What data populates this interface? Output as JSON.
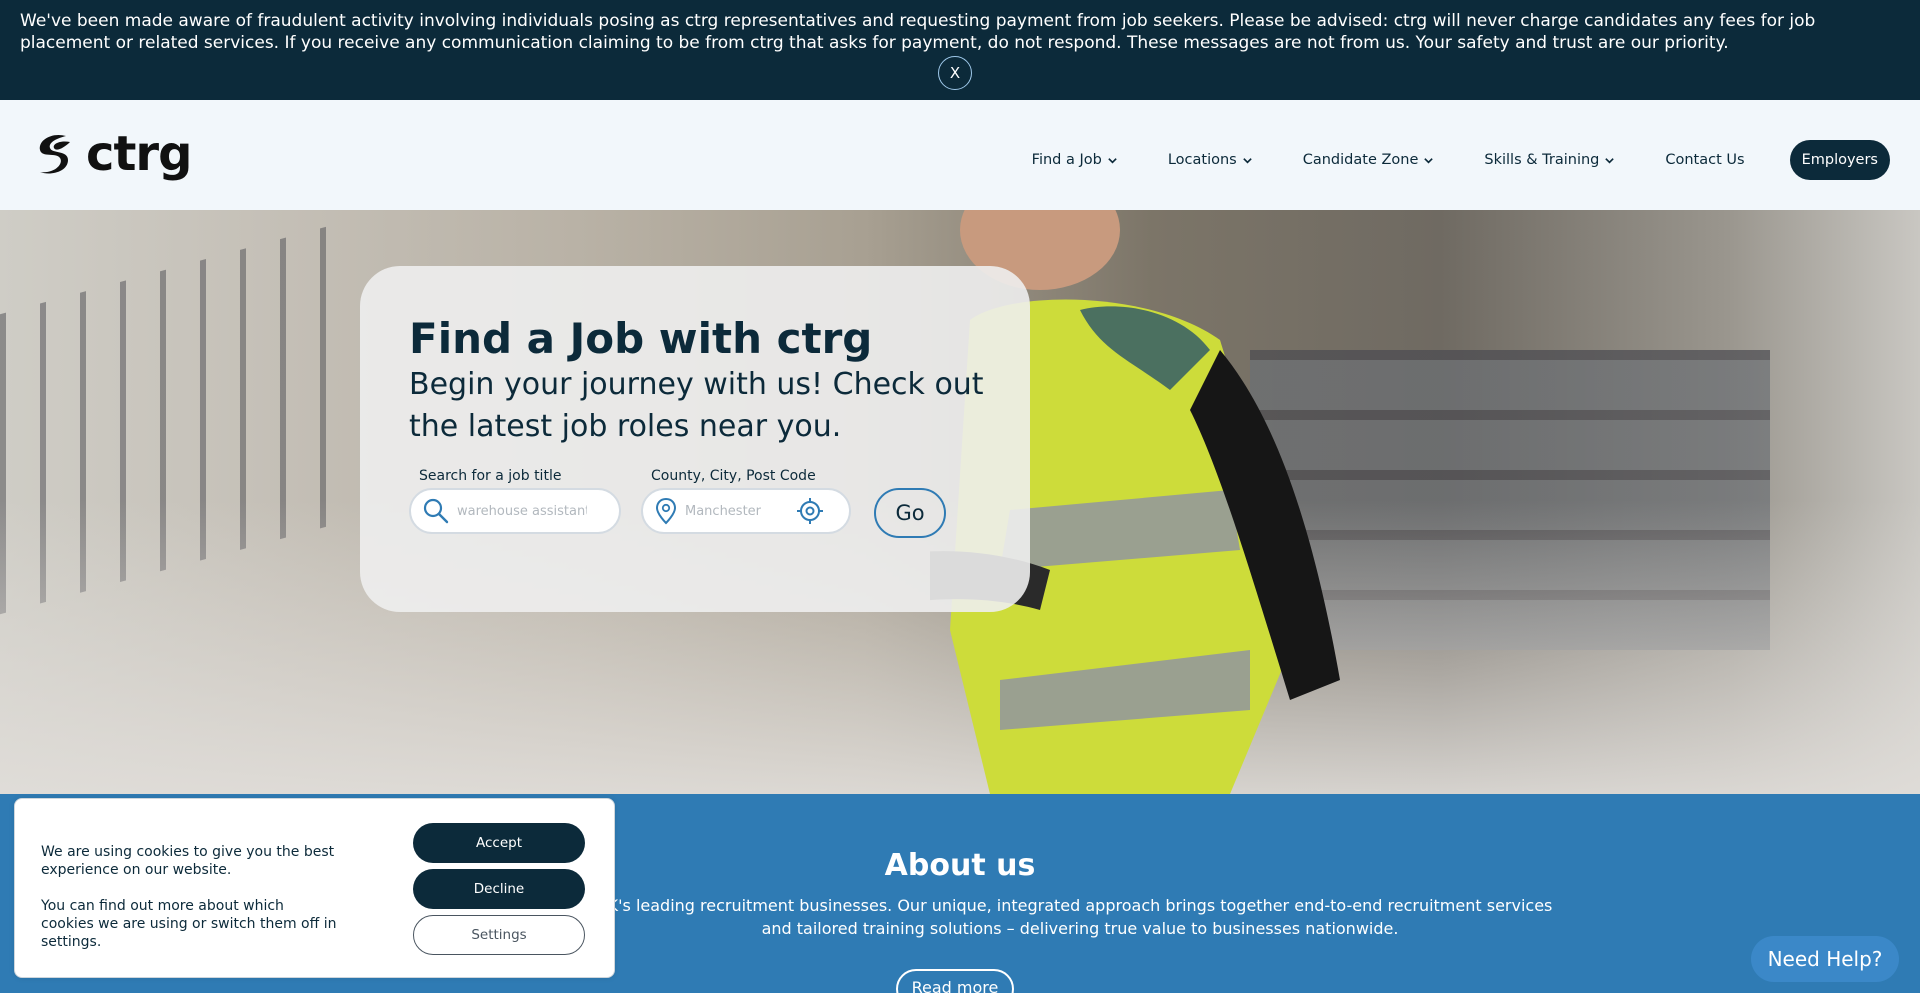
{
  "alert": {
    "message": "We've been made aware of fraudulent activity involving individuals posing as ctrg representatives and requesting payment from job seekers. Please be advised: ctrg will never charge candidates any fees for job placement or related services. If you receive any communication claiming to be from ctrg that asks for payment, do not respond. These messages are not from us. Your safety and trust are our priority.",
    "close_label": "X"
  },
  "header": {
    "logo_text": "ctrg",
    "nav": [
      {
        "label": "Find a Job",
        "dropdown": true
      },
      {
        "label": "Locations",
        "dropdown": true
      },
      {
        "label": "Candidate Zone",
        "dropdown": true
      },
      {
        "label": "Skills & Training",
        "dropdown": true
      },
      {
        "label": "Contact Us",
        "dropdown": false
      }
    ],
    "employers_label": "Employers"
  },
  "hero": {
    "title": "Find a Job with ctrg",
    "subtitle": "Begin your journey with us! Check out the latest job roles near you.",
    "job_label": "Search for a job title",
    "job_placeholder": "warehouse assistant...",
    "location_label": "County, City, Post Code",
    "location_placeholder": "Manchester",
    "go_label": "Go"
  },
  "about": {
    "title": "About us",
    "text": "K's leading recruitment businesses. Our unique, integrated approach brings together end-to-end recruitment services and tailored training solutions – delivering true value to businesses nationwide.",
    "read_more": "Read more"
  },
  "cookie": {
    "line1": "We are using cookies to give you the best experience on our website.",
    "line2": "You can find out more about which cookies we are using or switch them off in settings.",
    "accept": "Accept",
    "decline": "Decline",
    "settings": "Settings"
  },
  "help_label": "Need Help?",
  "colors": {
    "navy": "#0c2a3a",
    "blue": "#2f7bb4",
    "help_blue": "#3b88c8"
  }
}
